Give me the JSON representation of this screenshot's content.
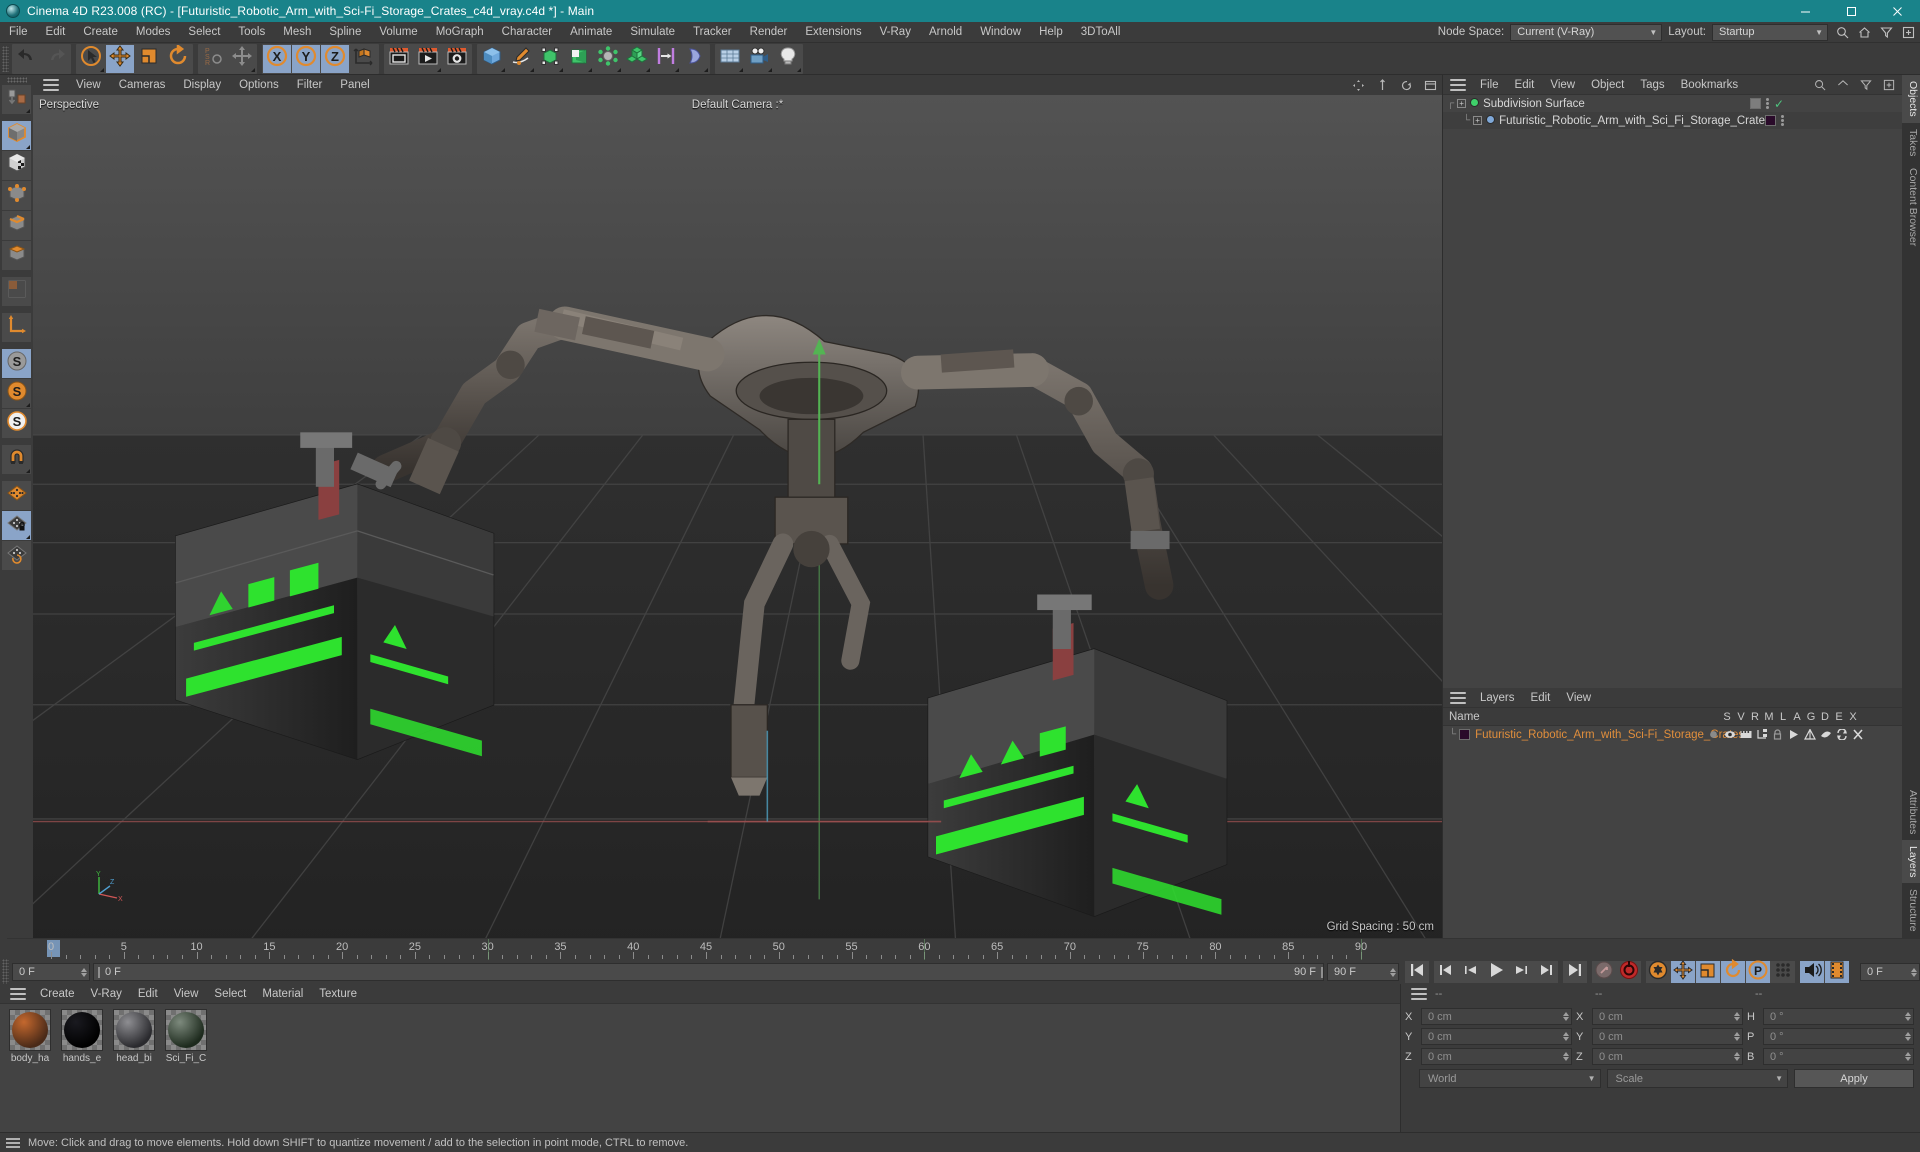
{
  "window": {
    "title": "Cinema 4D R23.008 (RC) - [Futuristic_Robotic_Arm_with_Sci-Fi_Storage_Crates_c4d_vray.c4d *] - Main",
    "minimize": "minimize-icon",
    "maximize": "maximize-icon",
    "close": "close-icon"
  },
  "menubar": {
    "items": [
      "File",
      "Edit",
      "Create",
      "Modes",
      "Select",
      "Tools",
      "Mesh",
      "Spline",
      "Volume",
      "MoGraph",
      "Character",
      "Animate",
      "Simulate",
      "Tracker",
      "Render",
      "Extensions",
      "V-Ray",
      "Arnold",
      "Window",
      "Help",
      "3DToAll"
    ],
    "node_space_label": "Node Space:",
    "node_space_value": "Current (V-Ray)",
    "layout_label": "Layout:",
    "layout_value": "Startup"
  },
  "toolbar": {
    "groups": [
      {
        "buttons": [
          {
            "name": "undo-button",
            "icon": "undo-arrow",
            "active": false,
            "tri": false
          },
          {
            "name": "redo-button",
            "icon": "redo-arrow",
            "active": false,
            "tri": false
          }
        ]
      },
      {
        "buttons": [
          {
            "name": "live-selection-tool",
            "icon": "cursor-circle",
            "active": false,
            "tri": true
          },
          {
            "name": "move-tool",
            "icon": "move-cross",
            "active": true,
            "tri": false
          },
          {
            "name": "scale-tool",
            "icon": "scale-box",
            "active": false,
            "tri": false
          },
          {
            "name": "rotate-tool",
            "icon": "rotate-arrows",
            "active": false,
            "tri": false
          }
        ]
      },
      {
        "buttons": [
          {
            "name": "psr-tool",
            "icon": "psr-text",
            "active": false,
            "tri": false
          },
          {
            "name": "world-object-axis-toggle",
            "icon": "move-cross-dark",
            "active": false,
            "tri": true
          }
        ]
      },
      {
        "buttons": [
          {
            "name": "lock-x-axis",
            "icon": "axis-x",
            "active": true,
            "tri": false
          },
          {
            "name": "lock-y-axis",
            "icon": "axis-y",
            "active": true,
            "tri": false
          },
          {
            "name": "lock-z-axis",
            "icon": "axis-z",
            "active": true,
            "tri": false
          },
          {
            "name": "world-coordinate-toggle",
            "icon": "world-axis-cube",
            "active": false,
            "tri": false
          }
        ]
      },
      {
        "buttons": [
          {
            "name": "render-view-button",
            "icon": "render-frame",
            "active": false,
            "tri": false
          },
          {
            "name": "render-to-picture-viewer-button",
            "icon": "render-play",
            "active": false,
            "tri": true
          },
          {
            "name": "render-settings-button",
            "icon": "render-gear",
            "active": false,
            "tri": false
          }
        ]
      },
      {
        "buttons": [
          {
            "name": "add-cube-button",
            "icon": "cube-blue",
            "active": false,
            "tri": true
          },
          {
            "name": "add-spline-button",
            "icon": "pen-spline",
            "active": false,
            "tri": true
          },
          {
            "name": "add-generator-button",
            "icon": "nurbs-green",
            "active": false,
            "tri": true
          },
          {
            "name": "add-spline-generator-button",
            "icon": "extrude-green",
            "active": false,
            "tri": true
          },
          {
            "name": "add-modeling-object-button",
            "icon": "atom-grey",
            "active": false,
            "tri": true
          },
          {
            "name": "add-array-button",
            "icon": "cubes-green",
            "active": false,
            "tri": true
          },
          {
            "name": "add-deformer-button",
            "icon": "bend-purple",
            "active": false,
            "tri": true
          },
          {
            "name": "add-field-button",
            "icon": "field-blue",
            "active": false,
            "tri": true
          }
        ]
      },
      {
        "buttons": [
          {
            "name": "add-environment-button",
            "icon": "floor-grid",
            "active": false,
            "tri": true
          },
          {
            "name": "add-camera-button",
            "icon": "camera",
            "active": false,
            "tri": true
          },
          {
            "name": "add-light-button",
            "icon": "light-bulb",
            "active": false,
            "tri": true
          }
        ]
      }
    ]
  },
  "left_tools": [
    {
      "name": "make-editable-button",
      "icon": "make-editable",
      "active": false,
      "tri": true
    },
    {
      "name": "model-mode-button",
      "icon": "model-cube",
      "active": true,
      "tri": true
    },
    {
      "name": "texture-mode-button",
      "icon": "texture-cube",
      "active": false,
      "tri": false
    },
    {
      "name": "points-mode-button",
      "icon": "points-cube",
      "active": false,
      "tri": false
    },
    {
      "name": "edges-mode-button",
      "icon": "edges-cube",
      "active": false,
      "tri": false
    },
    {
      "name": "polygons-mode-button",
      "icon": "polygons-cube",
      "active": false,
      "tri": false
    },
    {
      "name": "uv-mode-button",
      "icon": "uv-tiles",
      "active": false,
      "tri": false
    },
    {
      "name": "axis-mode-button",
      "icon": "axis-L",
      "active": false,
      "tri": false
    },
    {
      "name": "enable-axis-button",
      "icon": "s-grey",
      "active": true,
      "tri": false
    },
    {
      "name": "viewport-solo-single-button",
      "icon": "s-orange",
      "active": false,
      "tri": true
    },
    {
      "name": "viewport-solo-hierarchy-button",
      "icon": "s-white",
      "active": false,
      "tri": false
    },
    {
      "name": "snap-enable-button",
      "icon": "magnet",
      "active": false,
      "tri": true
    },
    {
      "name": "workplane-button",
      "icon": "grid-orange",
      "active": false,
      "tri": false
    },
    {
      "name": "lock-workplane-button",
      "icon": "grid-lock",
      "active": true,
      "tri": true
    },
    {
      "name": "planar-workplane-button",
      "icon": "grid-rotate",
      "active": false,
      "tri": false
    }
  ],
  "viewport": {
    "menu": [
      "View",
      "Cameras",
      "Display",
      "Options",
      "Filter",
      "Panel"
    ],
    "label": "Perspective",
    "camera": "Default Camera :*",
    "grid_spacing": "Grid Spacing : 50 cm",
    "axis_labels": {
      "x": "X",
      "y": "Y",
      "z": "Z"
    },
    "controls": [
      "pan-icon",
      "zoom-icon",
      "rotate-icon",
      "maximize-view-icon"
    ]
  },
  "object_manager": {
    "menu": [
      "File",
      "Edit",
      "View",
      "Object",
      "Tags",
      "Bookmarks"
    ],
    "tools": [
      "search-icon",
      "home-icon",
      "filter-icon",
      "add-layer-icon"
    ],
    "rows": [
      {
        "label": "Subdivision Surface",
        "indent": 0,
        "icon_color": "#3fd06a",
        "tag_color": "#7d7d7d",
        "has_check": true
      },
      {
        "label": "Futuristic_Robotic_Arm_with_Sci_Fi_Storage_Crates",
        "indent": 1,
        "icon_color": "#7fa8d8",
        "tag_color": "#2a0b2a",
        "has_check": false
      }
    ]
  },
  "layers_manager": {
    "menu": [
      "Layers",
      "Edit",
      "View"
    ],
    "name_header": "Name",
    "columns": [
      "S",
      "V",
      "R",
      "M",
      "L",
      "A",
      "G",
      "D",
      "E",
      "X"
    ],
    "rows": [
      {
        "label": "Futuristic_Robotic_Arm_with_Sci-Fi_Storage_Crates",
        "swatch": "#2a0b2a",
        "color": "#e08e3c"
      }
    ]
  },
  "vtabs_top": [
    "Objects",
    "Takes",
    "Content Browser"
  ],
  "vtabs_bottom": [
    "Attributes",
    "Layers",
    "Structure"
  ],
  "timeline": {
    "ticks": [
      0,
      5,
      10,
      15,
      20,
      25,
      30,
      35,
      40,
      45,
      50,
      55,
      60,
      65,
      70,
      75,
      80,
      85,
      90
    ],
    "min_frame": 0,
    "max_frame": 90,
    "current_frame_field": "0 F",
    "current_frame_bar": "0 F",
    "end_frame_label": "90 F",
    "end_frame_field": "90 F",
    "preview_frame_field": "0 F",
    "buttons": [
      {
        "name": "go-to-start-button",
        "icon": "skip-start",
        "active": false
      },
      {
        "name": "go-to-previous-key-button",
        "icon": "prev-key",
        "active": false
      },
      {
        "name": "go-to-previous-frame-button",
        "icon": "step-back",
        "active": false
      },
      {
        "name": "play-button",
        "icon": "play",
        "active": false
      },
      {
        "name": "go-to-next-frame-button",
        "icon": "step-forward",
        "active": false
      },
      {
        "name": "go-to-next-key-button",
        "icon": "next-key",
        "active": false
      },
      {
        "name": "go-to-end-button",
        "icon": "skip-end",
        "active": false
      },
      {
        "name": "record-active-objects-button",
        "icon": "record-key-grey",
        "active": false
      },
      {
        "name": "autokeying-button",
        "icon": "autokey-red",
        "active": false
      },
      {
        "name": "keyframe-selection-button",
        "icon": "key-gear-orange",
        "active": false
      },
      {
        "name": "position-key-button",
        "icon": "move-cross-key",
        "active": true
      },
      {
        "name": "scale-key-button",
        "icon": "scale-key",
        "active": true
      },
      {
        "name": "rotation-key-button",
        "icon": "rotate-key",
        "active": true
      },
      {
        "name": "parameter-key-button",
        "icon": "param-p-key",
        "active": true
      },
      {
        "name": "point-level-animation-button",
        "icon": "pla-dots",
        "active": false
      },
      {
        "name": "sound-button",
        "icon": "sound-waves",
        "active": true
      },
      {
        "name": "film-strip-button",
        "icon": "film-strip",
        "active": true
      }
    ]
  },
  "material_manager": {
    "menu": [
      "Create",
      "V-Ray",
      "Edit",
      "View",
      "Select",
      "Material",
      "Texture"
    ],
    "materials": [
      {
        "name": "body_ha",
        "color1": "#c4682e",
        "color2": "#4a2a18"
      },
      {
        "name": "hands_e",
        "color1": "#1a1a20",
        "color2": "#000000"
      },
      {
        "name": "head_bi",
        "color1": "#8e8e92",
        "color2": "#2a2a2e"
      },
      {
        "name": "Sci_Fi_C",
        "color1": "#7d8a7d",
        "color2": "#1d2a1d"
      }
    ]
  },
  "coordinates": {
    "headers": [
      "--",
      "--",
      "--"
    ],
    "rows": [
      {
        "l1": "X",
        "v1": "0 cm",
        "l2": "X",
        "v2": "0 cm",
        "l3": "H",
        "v3": "0 °"
      },
      {
        "l1": "Y",
        "v1": "0 cm",
        "l2": "Y",
        "v2": "0 cm",
        "l3": "P",
        "v3": "0 °"
      },
      {
        "l1": "Z",
        "v1": "0 cm",
        "l2": "Z",
        "v2": "0 cm",
        "l3": "B",
        "v3": "0 °"
      }
    ],
    "space_value": "World",
    "mode_value": "Scale",
    "apply_label": "Apply"
  },
  "statusbar": {
    "text": "Move: Click and drag to move elements. Hold down SHIFT to quantize movement / add to the selection in point mode, CTRL to remove."
  },
  "colors": {
    "title_bg": "#19838a",
    "accent_orange": "#e08e3c",
    "active_blue": "#8aa4c8",
    "panel_bg": "#3b3b3b",
    "list_bg": "#434343"
  }
}
